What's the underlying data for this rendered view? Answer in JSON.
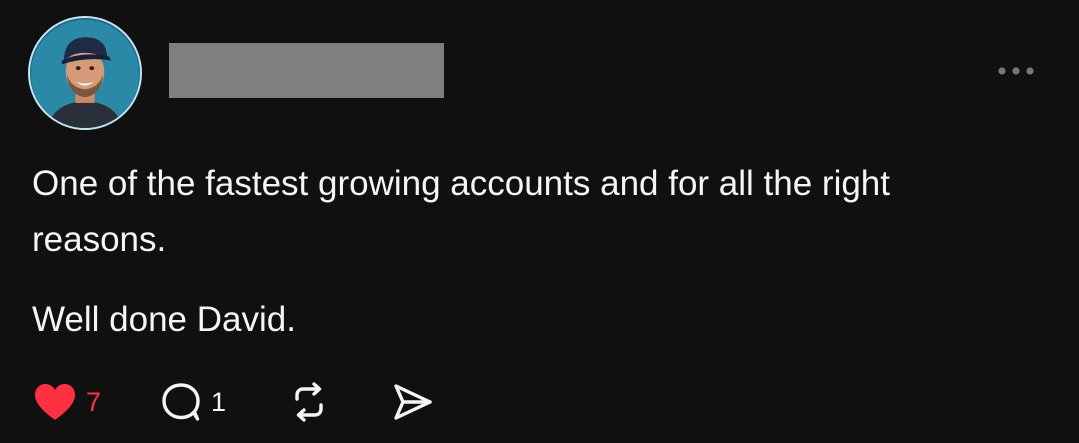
{
  "post": {
    "author": {
      "avatar_icon": "profile-photo",
      "username_redacted": true
    },
    "more_icon": "more-horizontal-icon",
    "text_paragraphs": [
      "One of the fastest growing accounts and for all the right reasons.",
      "Well done David."
    ],
    "actions": {
      "like": {
        "icon": "heart-icon",
        "count": "7",
        "liked": true,
        "color": "#ff3040"
      },
      "reply": {
        "icon": "comment-icon",
        "count": "1"
      },
      "repost": {
        "icon": "repost-icon"
      },
      "share": {
        "icon": "send-icon"
      }
    }
  },
  "colors": {
    "background": "#101010",
    "text": "#f3f5f7",
    "muted": "#777777",
    "like": "#ff3040",
    "redaction": "#7f7f7f"
  }
}
